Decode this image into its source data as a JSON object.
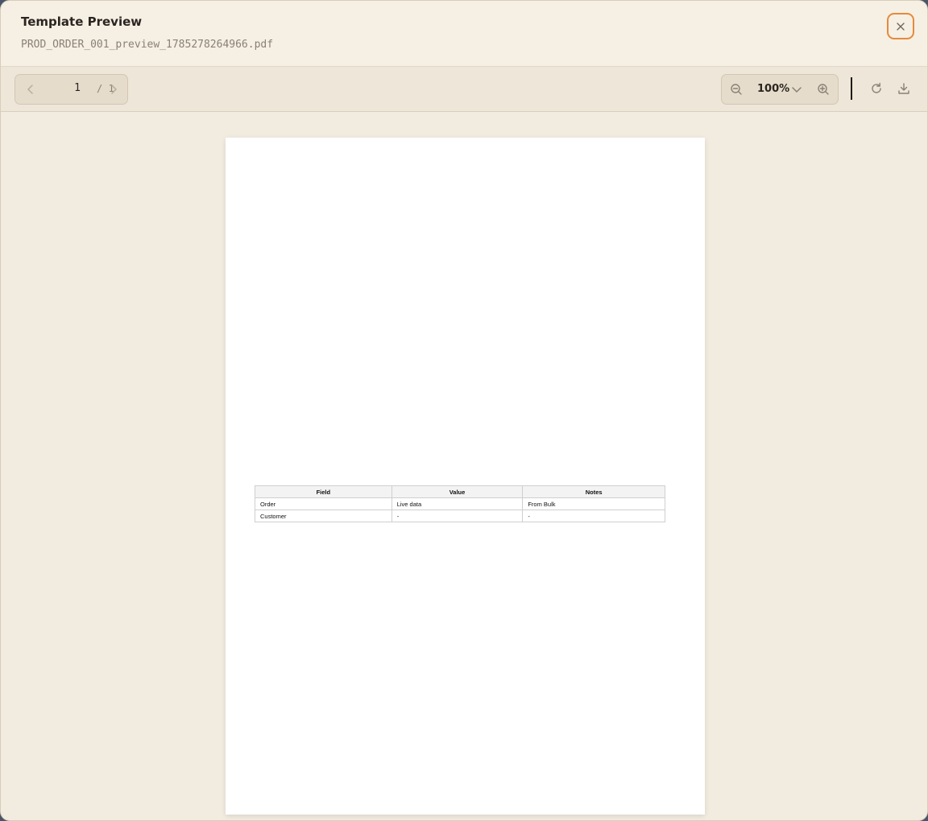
{
  "dialog": {
    "title": "Template Preview",
    "filename": "PROD_ORDER_001_preview_1785278264966.pdf"
  },
  "toolbar": {
    "page_current": "1",
    "page_total": "/ 1",
    "zoom": "100%"
  },
  "icons": {
    "close": "close-icon",
    "prev": "chevron-left-icon",
    "next": "chevron-right-icon",
    "zoom_out": "zoom-out-icon",
    "zoom_dropdown": "chevron-down-icon",
    "zoom_in": "zoom-in-icon",
    "rotate": "rotate-icon",
    "download": "download-icon"
  },
  "colors": {
    "accent": "#e58a3c",
    "background": "#f3ece0",
    "toolbar": "#eee6d8"
  },
  "document": {
    "table": {
      "headers": [
        "Field",
        "Value",
        "Notes"
      ],
      "rows": [
        [
          "Order",
          "Live data",
          "From Bulk"
        ],
        [
          "Customer",
          "-",
          "-"
        ]
      ]
    }
  }
}
